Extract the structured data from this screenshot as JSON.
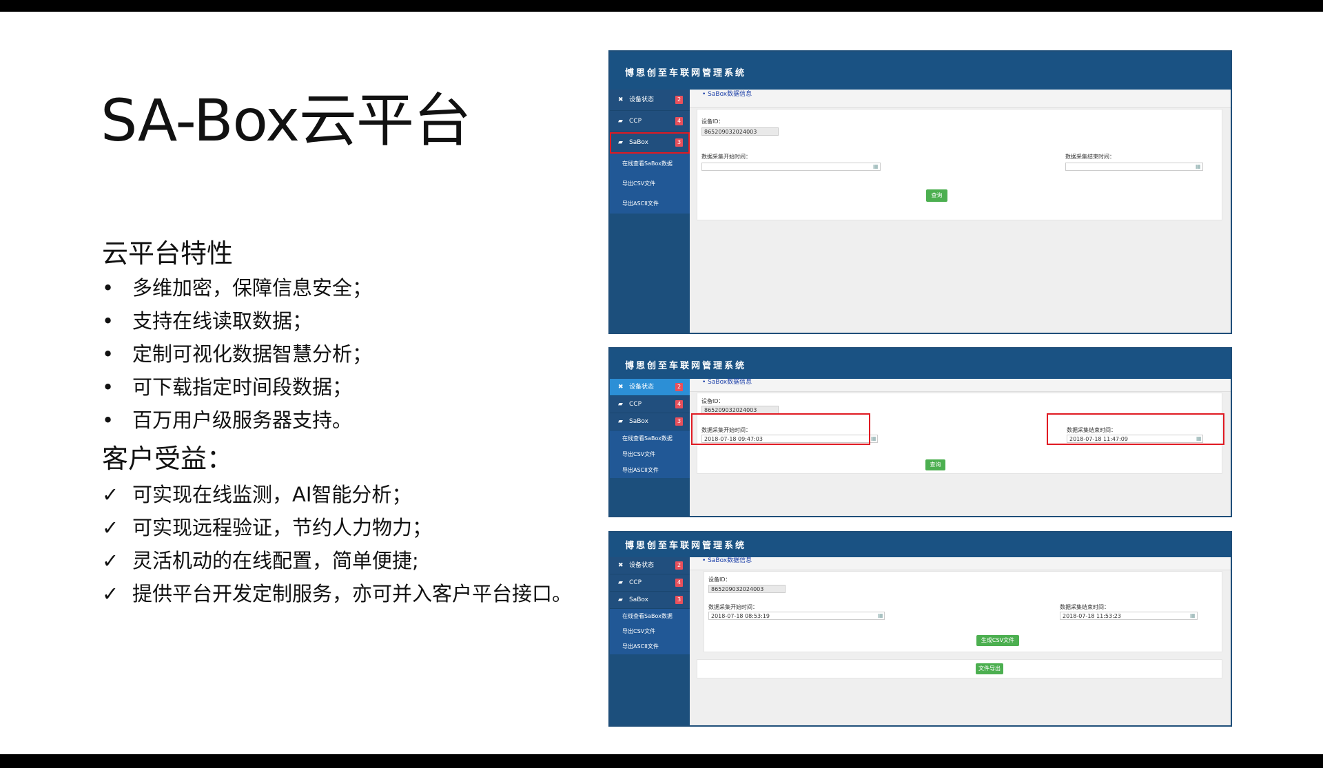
{
  "slide": {
    "title": "SA-Box云平台",
    "features_heading": "云平台特性",
    "features": [
      "多维加密，保障信息安全；",
      "支持在线读取数据；",
      "定制可视化数据智慧分析；",
      "可下载指定时间段数据；",
      "百万用户级服务器支持。"
    ],
    "bullet_mark": "•",
    "benefits_heading": "客户受益：",
    "benefits": [
      "可实现在线监测，AI智能分析；",
      "可实现远程验证，节约人力物力；",
      "灵活机动的在线配置，简单便捷;",
      "提供平台开发定制服务，亦可并入客户平台接口。"
    ],
    "check_mark": "✓"
  },
  "app": {
    "title": "博思创至车联网管理系统",
    "menu": [
      {
        "label": "设备状态",
        "badge": "2",
        "icon": "wrench-icon"
      },
      {
        "label": "CCP",
        "badge": "4",
        "icon": "car-icon"
      },
      {
        "label": "SaBox",
        "badge": "3",
        "icon": "car-icon"
      }
    ],
    "submenu": [
      "在线查看SaBox数据",
      "导出CSV文件",
      "导出ASCII文件"
    ],
    "breadcrumb": "• SaBox数据信息",
    "device_id_label": "设备ID：",
    "device_id": "865209032024003",
    "start_label": "数据采集开始时间：",
    "end_label": "数据采集结束时间：",
    "calendar_glyph": "▦",
    "query_button": "查询",
    "gen_csv_button": "生成CSV文件",
    "export_button": "文件导出"
  },
  "panel2": {
    "start_time": "2018-07-18 09:47:03",
    "end_time": "2018-07-18 11:47:09"
  },
  "panel3": {
    "start_time": "2018-07-18 08:53:19",
    "end_time": "2018-07-18 11:53:23"
  },
  "colors": {
    "header_blue": "#1a5283",
    "sidebar_blue": "#214f7e",
    "active_blue": "#2c8fd6",
    "badge_red": "#e8505b",
    "highlight_red": "#e01a22",
    "button_green": "#4caf50"
  }
}
